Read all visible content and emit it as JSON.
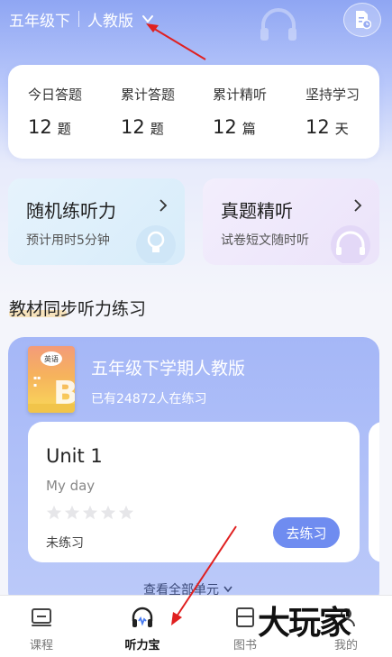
{
  "header": {
    "grade": "五年级下",
    "edition": "人教版"
  },
  "stats": [
    {
      "label": "今日答题",
      "value": "12",
      "unit": "题"
    },
    {
      "label": "累计答题",
      "value": "12",
      "unit": "题"
    },
    {
      "label": "累计精听",
      "value": "12",
      "unit": "篇"
    },
    {
      "label": "坚持学习",
      "value": "12",
      "unit": "天"
    }
  ],
  "cards": [
    {
      "title": "随机练听力",
      "subtitle": "预计用时5分钟",
      "bg": "#dff0fb"
    },
    {
      "title": "真题精听",
      "subtitle": "试卷短文随时听",
      "bg": "#efe9fb"
    }
  ],
  "section_title": "教材同步听力练习",
  "book": {
    "title": "五年级下学期人教版",
    "learners": "已有24872人在练习",
    "cover_badge": "英语"
  },
  "unit": {
    "title": "Unit 1",
    "subtitle": "My day",
    "stars": 0,
    "status": "未练习",
    "button": "去练习"
  },
  "view_all": "查看全部单元",
  "tabs": [
    {
      "label": "课程",
      "icon": "course-icon"
    },
    {
      "label": "听力宝",
      "icon": "headphones-icon"
    },
    {
      "label": "图书",
      "icon": "book-icon"
    },
    {
      "label": "我的",
      "icon": "profile-icon"
    }
  ],
  "watermark": "大玩家",
  "colors": {
    "accent": "#6f8cf0",
    "annotation_arrow": "#e02020"
  }
}
